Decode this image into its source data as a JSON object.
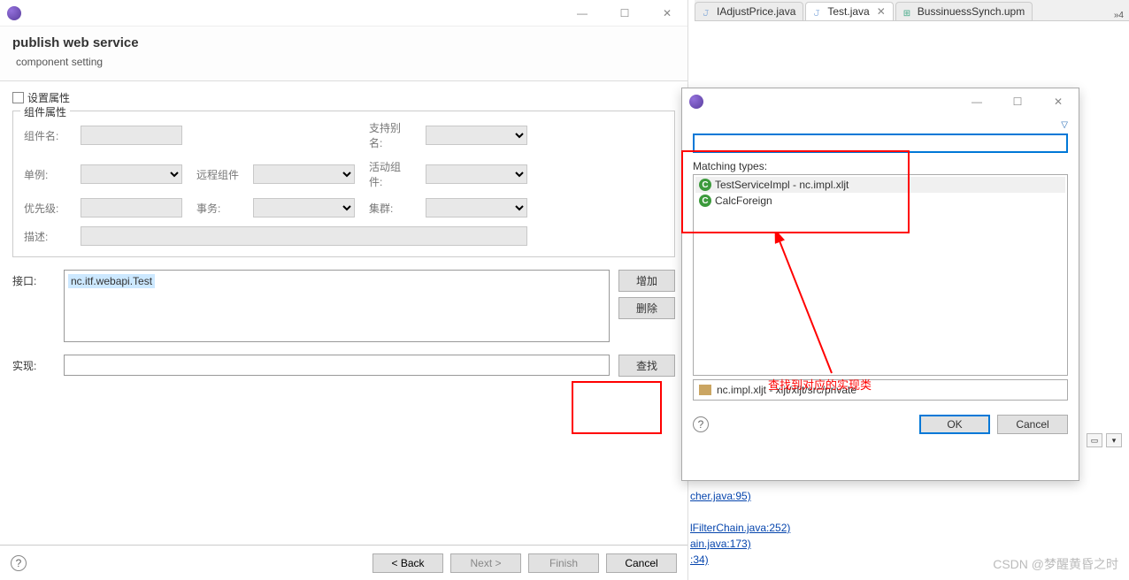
{
  "tabs": [
    {
      "label": "IAdjustPrice.java",
      "type": "java",
      "active": false
    },
    {
      "label": "Test.java",
      "type": "java",
      "active": true,
      "closeable": true
    },
    {
      "label": "BussinuessSynch.upm",
      "type": "upm",
      "active": false
    }
  ],
  "more_tabs": "»4",
  "wizard": {
    "title": "publish web service",
    "subtitle": "component setting",
    "set_attrs": "设置属性",
    "group": {
      "legend": "组件属性",
      "labels": {
        "name": "组件名:",
        "alias": "支持别名:",
        "singleton": "单例:",
        "remote": "远程组件",
        "active": "活动组件:",
        "priority": "优先级:",
        "transaction": "事务:",
        "cluster": "集群:",
        "desc": "描述:"
      }
    },
    "interface": {
      "label": "接口:",
      "value": "nc.itf.webapi.Test",
      "add": "增加",
      "remove": "删除"
    },
    "impl": {
      "label": "实现:",
      "find": "查找"
    },
    "footer": {
      "back": "< Back",
      "next": "Next >",
      "finish": "Finish",
      "cancel": "Cancel"
    }
  },
  "typedialog": {
    "matching": "Matching types:",
    "results": [
      {
        "label": "TestServiceImpl - nc.impl.xljt",
        "selected": true
      },
      {
        "label": "CalcForeign",
        "selected": false
      }
    ],
    "pkg_status": "nc.impl.xljt - xljt/xljt/src/private",
    "ok": "OK",
    "cancel": "Cancel"
  },
  "annotation": "查找到对应的实现类",
  "codebg": {
    "l1": "cher.java:95)",
    "l2": "lFilterChain.java:252)",
    "l3": "ain.java:173)",
    "l4": ":34)"
  },
  "watermark": "CSDN @梦醒黄昏之时"
}
